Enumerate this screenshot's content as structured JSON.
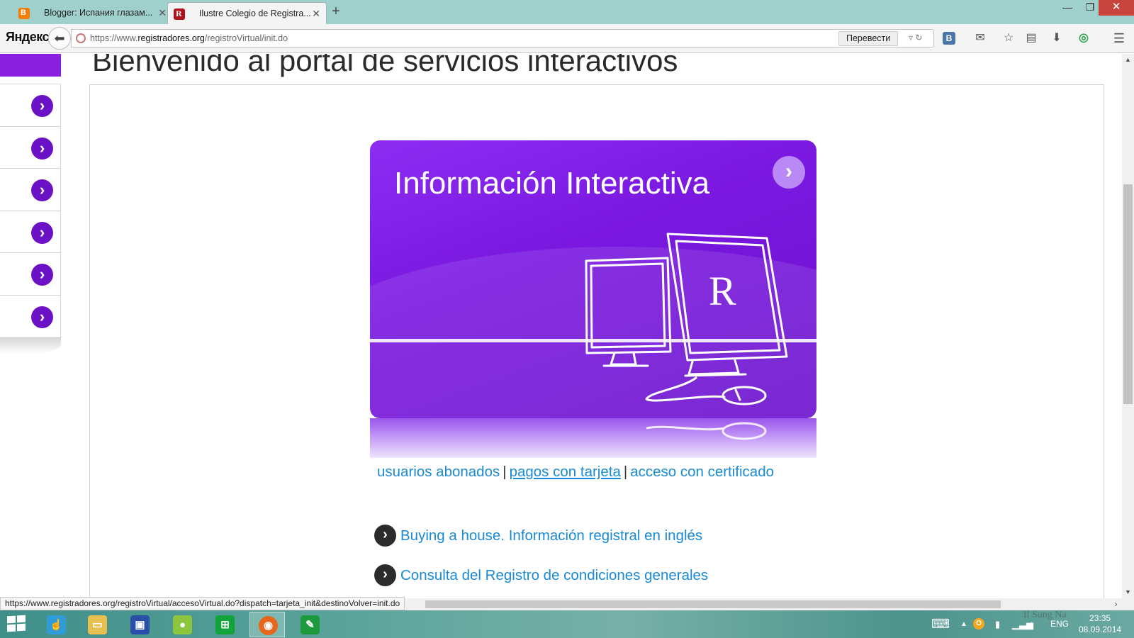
{
  "browser": {
    "tabs": [
      {
        "title": "Blogger: Испания глазам...",
        "favicon": "blogger-icon",
        "active": false
      },
      {
        "title": "Ilustre Colegio de Registra...",
        "favicon": "registradores-icon",
        "active": true
      }
    ],
    "brand": "Яндекс",
    "url_prefix": "https://www.",
    "url_host": "registradores.org",
    "url_path": "/registroVirtual/init.do",
    "translate_label": "Перевести",
    "status_url": "https://www.registradores.org/registroVirtual/accesoVirtual.do?dispatch=tarjeta_init&destinoVolver=init.do"
  },
  "page": {
    "title": "Bienvenido al portal de servicios interactivos",
    "card": {
      "title": "Información Interactiva",
      "accent": "#7a18e0"
    },
    "links": {
      "usuarios": "usuarios abonados",
      "pagos": "pagos con tarjeta",
      "acceso": "acceso con certificado",
      "separator": "|"
    },
    "bullet_links": [
      {
        "label": "Buying a house. Información registral en inglés"
      },
      {
        "label": "Consulta del Registro de condiciones generales"
      }
    ]
  },
  "taskbar": {
    "apps": [
      "windows-start",
      "touch-app",
      "file-explorer",
      "media-app",
      "pea-app",
      "store-app",
      "firefox",
      "green-app"
    ],
    "lang": "ENG",
    "time": "23:35",
    "date": "08.09.2014"
  },
  "watermark": "Il Sung Na",
  "colors": {
    "purple": "#8a1fe0",
    "link": "#1a8ad4",
    "tab_strip": "#9fd0cb"
  }
}
